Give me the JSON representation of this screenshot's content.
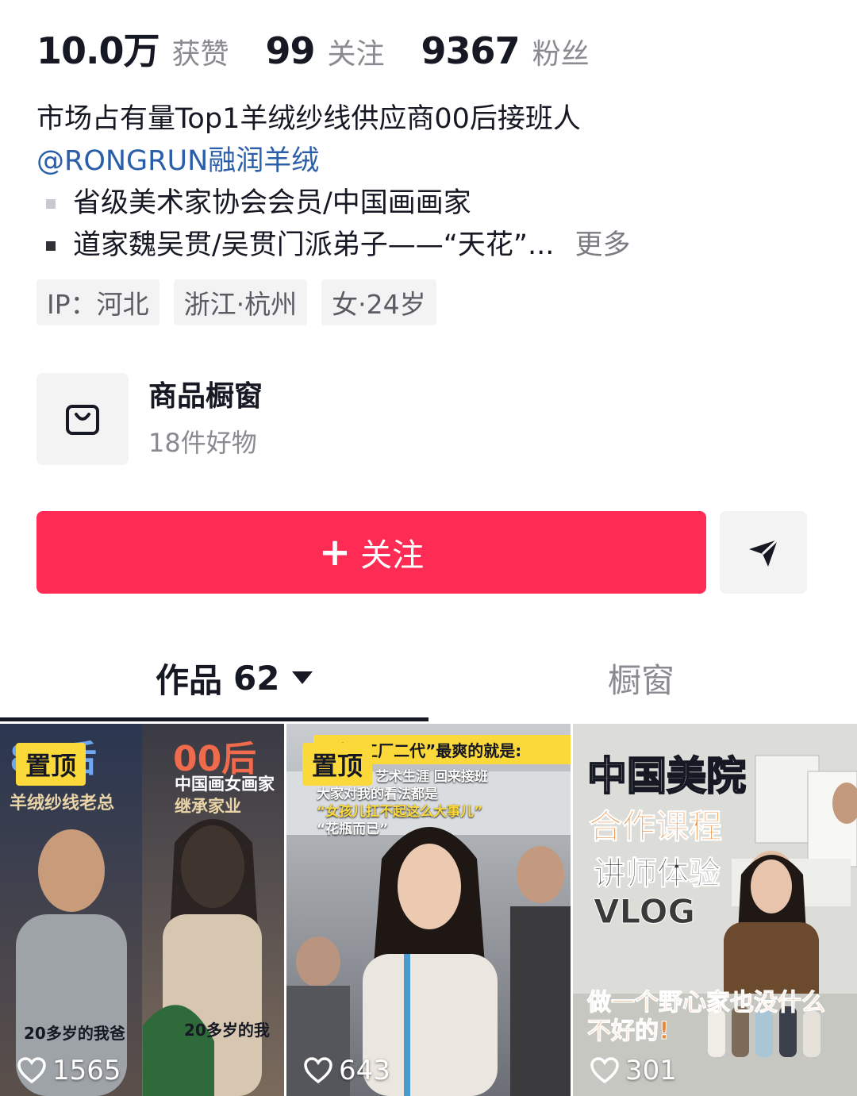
{
  "stats": [
    {
      "value": "10.0万",
      "label": "获赞"
    },
    {
      "value": "99",
      "label": "关注"
    },
    {
      "value": "9367",
      "label": "粉丝"
    }
  ],
  "bio": {
    "line1": "市场占有量Top1羊绒纱线供应商00后接班人",
    "mention": "@RONGRUN融润羊绒",
    "bullet1": "省级美术家协会会员/中国画画家",
    "bullet2": "道家魏吴贯/吴贯门派弟子——“天花”...",
    "more": "更多"
  },
  "tags": [
    "IP：河北",
    "浙江·杭州",
    "女·24岁"
  ],
  "showcase": {
    "title": "商品橱窗",
    "subtitle": "18件好物",
    "icon": "shopping-bag-icon"
  },
  "actions": {
    "follow_plus": "+",
    "follow_label": "关注",
    "share_icon": "send-icon"
  },
  "tabs": {
    "works_label": "作品",
    "works_count": "62",
    "window_label": "橱窗"
  },
  "videos": [
    {
      "pinned": "置顶",
      "likes": "1565",
      "left_top": "80后",
      "left_sub": "羊绒纱线老总",
      "right_top": "00后",
      "right_sub1": "中国画女画家",
      "right_sub2": "继承家业",
      "left_caption": "20多岁的我爸",
      "right_caption": "20多岁的我"
    },
    {
      "pinned": "置顶",
      "likes": "643",
      "head": "作为“工厂二代”最爽的就是:",
      "line1": "艺术生涯 回来接班",
      "line2": "大家对我的看法都是",
      "line3": "“女孩儿扛不起这么大事儿”",
      "line4": "“花瓶而已”"
    },
    {
      "likes": "301",
      "title1": "中国美院",
      "title2": "合作课程",
      "title3": "讲师体验",
      "title4": "VLOG",
      "caption1": "做一个野心家也没什么",
      "caption2": "不好的!"
    }
  ],
  "colors": {
    "follow": "#fe2c55",
    "mention": "#2a5ea8",
    "pin": "#fcd93b",
    "muted": "#8a8b91"
  }
}
